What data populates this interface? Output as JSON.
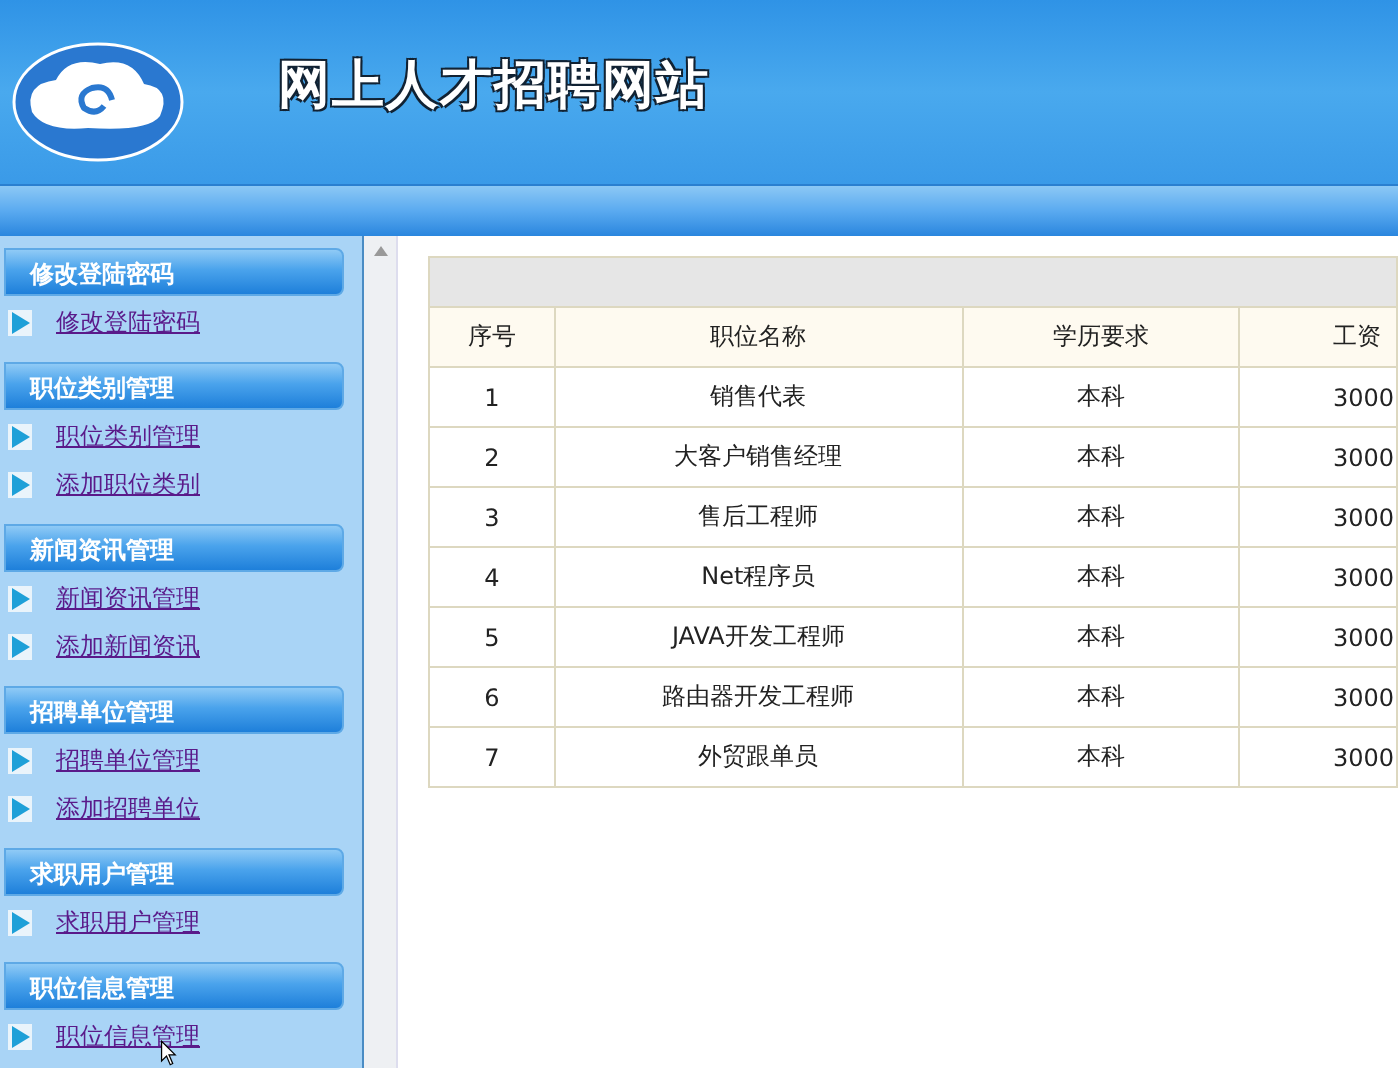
{
  "header": {
    "title": "网上人才招聘网站"
  },
  "sidebar": {
    "groups": [
      {
        "title": "修改登陆密码",
        "items": [
          "修改登陆密码"
        ]
      },
      {
        "title": "职位类别管理",
        "items": [
          "职位类别管理",
          "添加职位类别"
        ]
      },
      {
        "title": "新闻资讯管理",
        "items": [
          "新闻资讯管理",
          "添加新闻资讯"
        ]
      },
      {
        "title": "招聘单位管理",
        "items": [
          "招聘单位管理",
          "添加招聘单位"
        ]
      },
      {
        "title": "求职用户管理",
        "items": [
          "求职用户管理"
        ]
      },
      {
        "title": "职位信息管理",
        "items": [
          "职位信息管理"
        ]
      }
    ]
  },
  "table": {
    "columns": [
      "序号",
      "职位名称",
      "学历要求",
      "工资"
    ],
    "rows": [
      [
        "1",
        "销售代表",
        "本科",
        "3000"
      ],
      [
        "2",
        "大客户销售经理",
        "本科",
        "3000"
      ],
      [
        "3",
        "售后工程师",
        "本科",
        "3000"
      ],
      [
        "4",
        "Net程序员",
        "本科",
        "3000"
      ],
      [
        "5",
        "JAVA开发工程师",
        "本科",
        "3000"
      ],
      [
        "6",
        "路由器开发工程师",
        "本科",
        "3000"
      ],
      [
        "7",
        "外贸跟单员",
        "本科",
        "3000"
      ]
    ]
  }
}
